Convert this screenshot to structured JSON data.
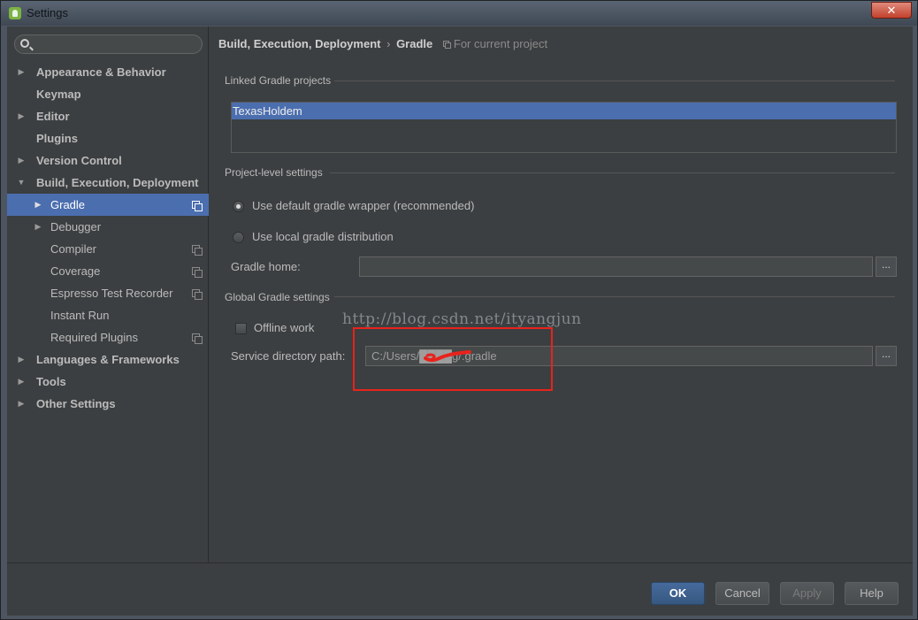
{
  "window": {
    "title": "Settings",
    "close_label": "✕"
  },
  "search": {
    "placeholder": "",
    "value": ""
  },
  "sidebar": {
    "items": [
      {
        "label": "Appearance & Behavior",
        "arrow": "▶"
      },
      {
        "label": "Keymap"
      },
      {
        "label": "Editor",
        "arrow": "▶"
      },
      {
        "label": "Plugins"
      },
      {
        "label": "Version Control",
        "arrow": "▶"
      },
      {
        "label": "Build, Execution, Deployment",
        "arrow": "▼"
      },
      {
        "label": "Gradle",
        "arrow": "▶",
        "selected": true
      },
      {
        "label": "Debugger",
        "arrow": "▶"
      },
      {
        "label": "Compiler"
      },
      {
        "label": "Coverage"
      },
      {
        "label": "Espresso Test Recorder"
      },
      {
        "label": "Instant Run"
      },
      {
        "label": "Required Plugins"
      },
      {
        "label": "Languages & Frameworks",
        "arrow": "▶"
      },
      {
        "label": "Tools",
        "arrow": "▶"
      },
      {
        "label": "Other Settings",
        "arrow": "▶"
      }
    ]
  },
  "breadcrumb": {
    "parent": "Build, Execution, Deployment",
    "separator": "›",
    "current": "Gradle",
    "scope": "For current project"
  },
  "linked": {
    "heading": "Linked Gradle projects",
    "projects": [
      "TexasHoldem"
    ]
  },
  "project_level": {
    "heading": "Project-level settings",
    "option_default": "Use default gradle wrapper (recommended)",
    "option_local": "Use local gradle distribution",
    "gradle_home_label": "Gradle home:",
    "gradle_home_value": "",
    "browse_label": "..."
  },
  "global": {
    "heading": "Global Gradle settings",
    "offline_label": "Offline work",
    "service_dir_label": "Service directory path:",
    "service_dir_value": "C:/Users/████g/.gradle",
    "browse_label": "..."
  },
  "watermark": "http://blog.csdn.net/ityangjun",
  "buttons": {
    "ok": "OK",
    "cancel": "Cancel",
    "apply": "Apply",
    "help": "Help"
  },
  "colors": {
    "selection": "#4b6eaf",
    "annotation": "#e8231c",
    "background": "#3c3f41"
  }
}
